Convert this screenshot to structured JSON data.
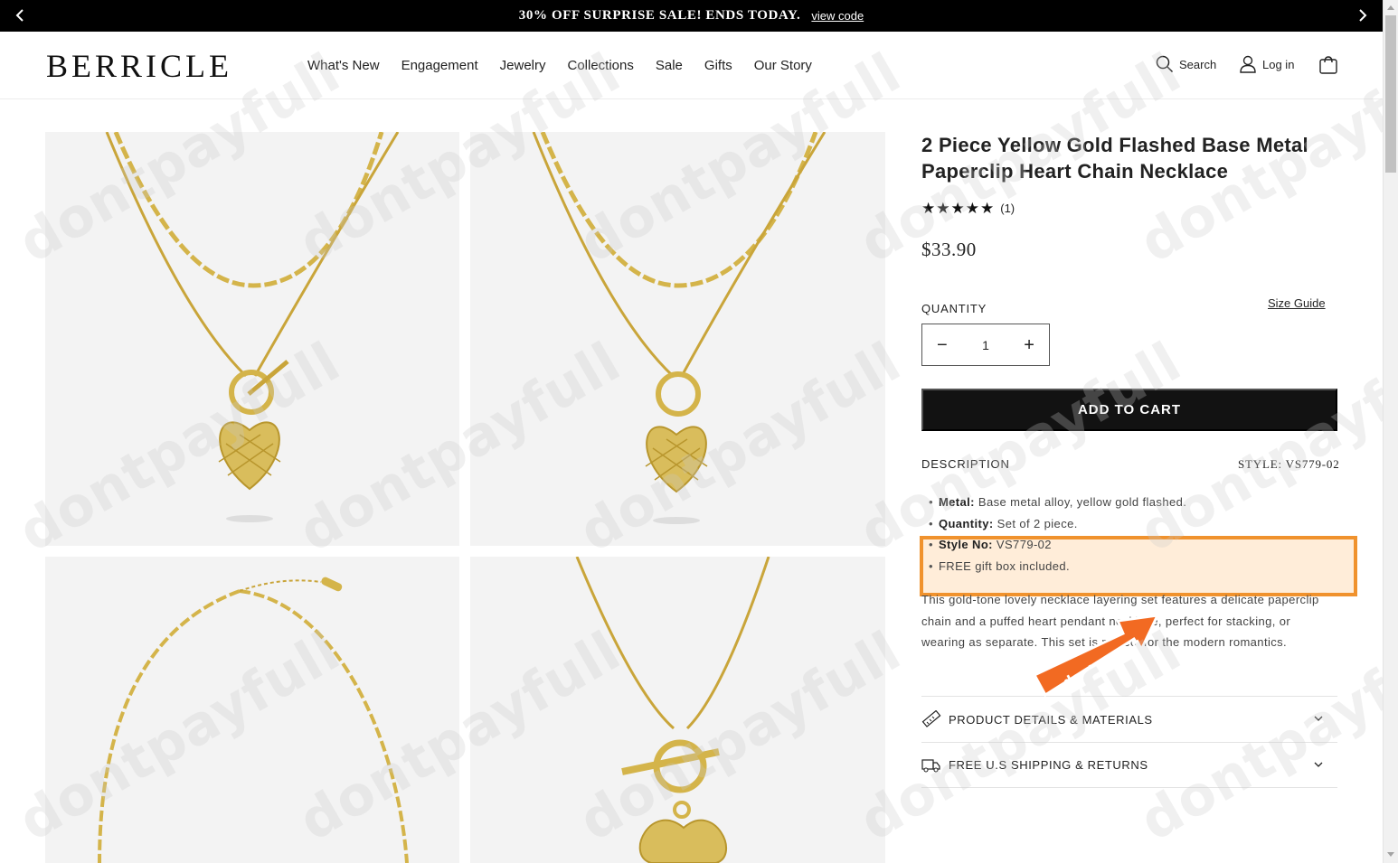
{
  "announcement": {
    "message": "30% OFF SURPRISE SALE! ENDS TODAY.",
    "link": "view code"
  },
  "header": {
    "logo": "BERRICLE",
    "nav": [
      "What's New",
      "Engagement",
      "Jewelry",
      "Collections",
      "Sale",
      "Gifts",
      "Our Story"
    ],
    "search_label": "Search",
    "login_label": "Log in"
  },
  "product": {
    "title": "2 Piece Yellow Gold Flashed Base Metal Paperclip Heart Chain Necklace",
    "rating_stars": 5,
    "review_count": "(1)",
    "price": "$33.90",
    "quantity_label": "QUANTITY",
    "size_guide": "Size Guide",
    "quantity_value": "1",
    "add_to_cart": "ADD TO CART",
    "description_label": "DESCRIPTION",
    "style_label": "STYLE: VS779-02",
    "bullets": [
      {
        "key": "Metal:",
        "value": " Base metal alloy, yellow gold flashed."
      },
      {
        "key": "Quantity:",
        "value": " Set of 2 piece."
      },
      {
        "key": "Style No:",
        "value": " VS779-02"
      },
      {
        "key": "",
        "value": "FREE gift box included."
      }
    ],
    "paragraph": "This gold-tone lovely necklace layering set features a delicate paperclip chain and a puffed heart pendant necklace, perfect for stacking, or wearing as separate. This set is perfect for the modern romantics.",
    "accordion": [
      {
        "label": "PRODUCT DETAILS & MATERIALS",
        "icon": "ruler-icon"
      },
      {
        "label": "FREE U.S SHIPPING & RETURNS",
        "icon": "truck-icon"
      }
    ]
  },
  "overlay": {
    "watermark": "dontpayfull",
    "sticker_text": "dontpayfull",
    "highlight_color": "#f0922d"
  },
  "colors": {
    "announcement_bg": "#000000",
    "button_bg": "#121212",
    "accent_orange": "#f0922d",
    "gold": "#d4b44a"
  }
}
